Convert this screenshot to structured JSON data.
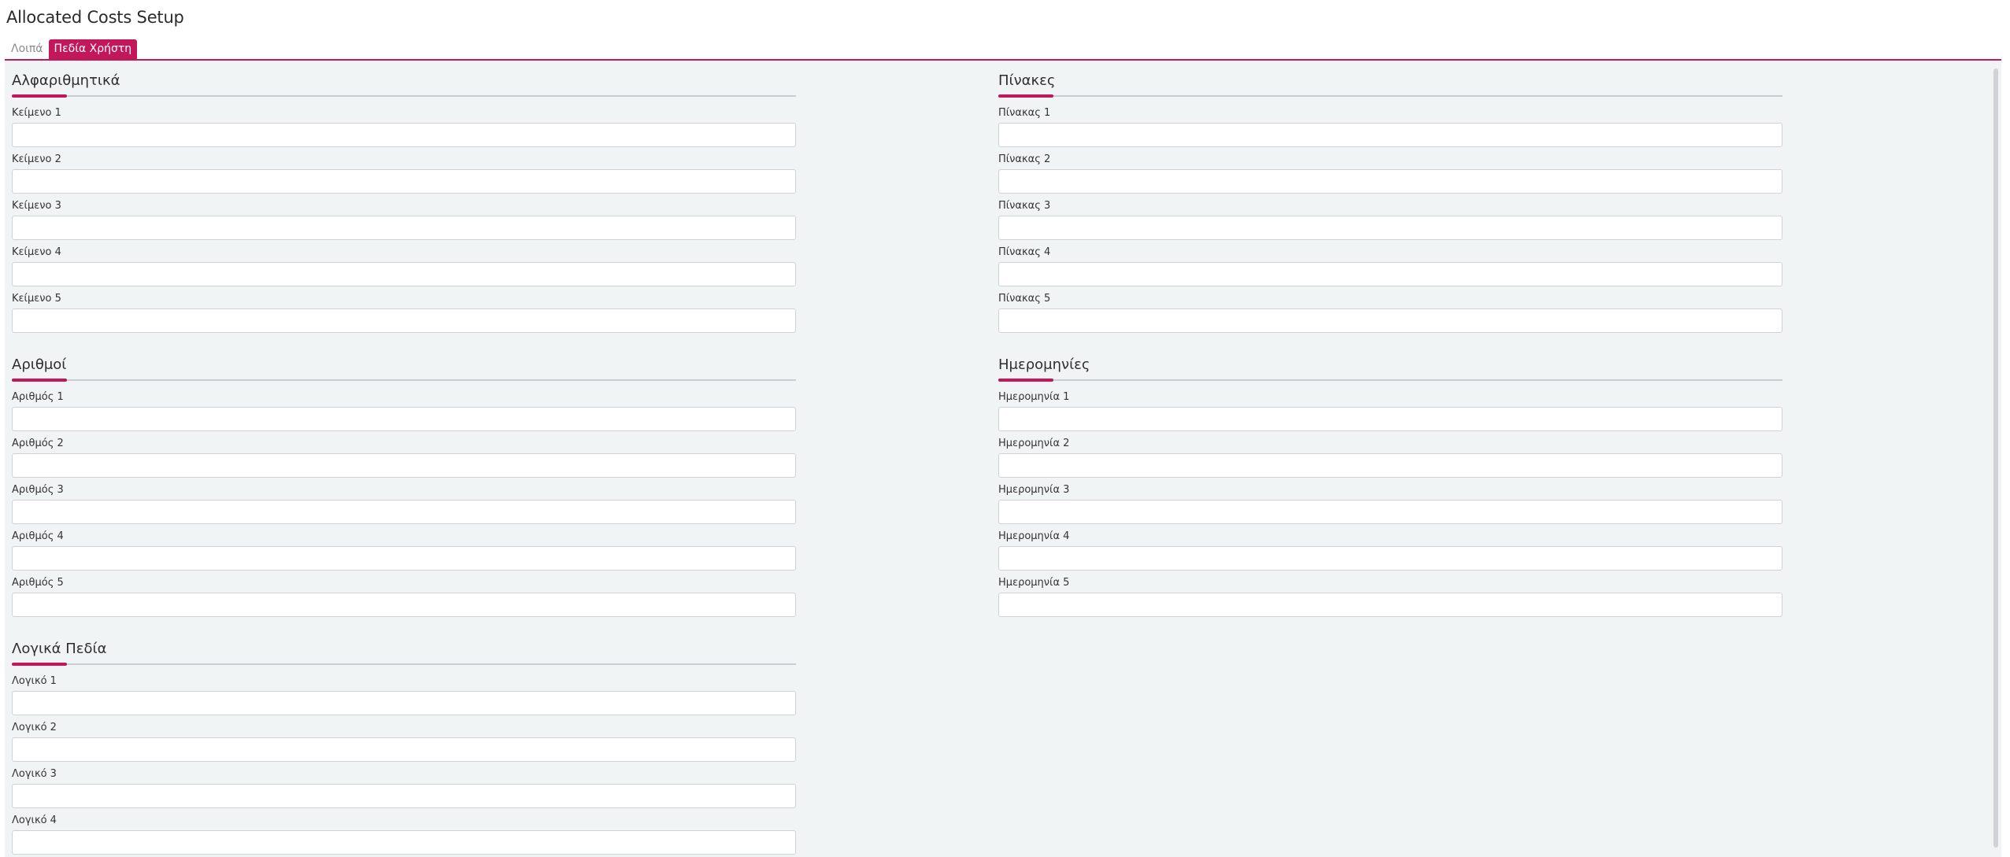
{
  "page": {
    "title": "Allocated Costs Setup"
  },
  "tabs": [
    {
      "label": "Λοιπά",
      "active": false
    },
    {
      "label": "Πεδία Χρήστη",
      "active": true
    }
  ],
  "colors": {
    "accent": "#c2185b",
    "background": "#f1f4f5"
  },
  "sections": {
    "alphanumeric": {
      "title": "Αλφαριθμητικά",
      "fields": [
        {
          "label": "Κείμενο 1",
          "value": ""
        },
        {
          "label": "Κείμενο 2",
          "value": ""
        },
        {
          "label": "Κείμενο 3",
          "value": ""
        },
        {
          "label": "Κείμενο 4",
          "value": ""
        },
        {
          "label": "Κείμενο 5",
          "value": ""
        }
      ]
    },
    "numbers": {
      "title": "Αριθμοί",
      "fields": [
        {
          "label": "Αριθμός 1",
          "value": ""
        },
        {
          "label": "Αριθμός 2",
          "value": ""
        },
        {
          "label": "Αριθμός 3",
          "value": ""
        },
        {
          "label": "Αριθμός 4",
          "value": ""
        },
        {
          "label": "Αριθμός 5",
          "value": ""
        }
      ]
    },
    "logical": {
      "title": "Λογικά Πεδία",
      "fields": [
        {
          "label": "Λογικό 1",
          "value": ""
        },
        {
          "label": "Λογικό 2",
          "value": ""
        },
        {
          "label": "Λογικό 3",
          "value": ""
        },
        {
          "label": "Λογικό 4",
          "value": ""
        }
      ]
    },
    "tables": {
      "title": "Πίνακες",
      "fields": [
        {
          "label": "Πίνακας 1",
          "value": ""
        },
        {
          "label": "Πίνακας 2",
          "value": ""
        },
        {
          "label": "Πίνακας 3",
          "value": ""
        },
        {
          "label": "Πίνακας 4",
          "value": ""
        },
        {
          "label": "Πίνακας 5",
          "value": ""
        }
      ]
    },
    "dates": {
      "title": "Ημερομηνίες",
      "fields": [
        {
          "label": "Ημερομηνία 1",
          "value": ""
        },
        {
          "label": "Ημερομηνία 2",
          "value": ""
        },
        {
          "label": "Ημερομηνία 3",
          "value": ""
        },
        {
          "label": "Ημερομηνία 4",
          "value": ""
        },
        {
          "label": "Ημερομηνία 5",
          "value": ""
        }
      ]
    }
  }
}
